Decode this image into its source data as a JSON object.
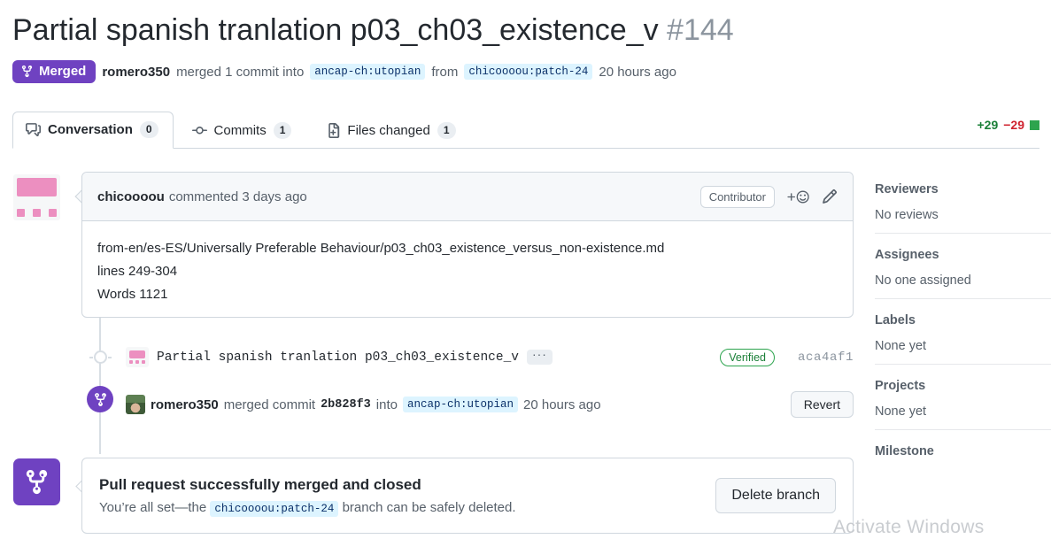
{
  "header": {
    "title": "Partial spanish tranlation p03_ch03_existence_v",
    "number": "#144",
    "state_badge": "Merged",
    "state_icon": "git-merge-icon",
    "merger": "romero350",
    "merge_text": "merged 1 commit into",
    "base_branch": "ancap-ch:utopian",
    "from_word": "from",
    "head_branch": "chicoooou:patch-24",
    "time": "20 hours ago",
    "state_color": "#6f42c1"
  },
  "tabs": [
    {
      "label": "Conversation",
      "count": "0",
      "icon": "comment-discussion-icon",
      "active": true
    },
    {
      "label": "Commits",
      "count": "1",
      "icon": "git-commit-icon",
      "active": false
    },
    {
      "label": "Files changed",
      "count": "1",
      "icon": "file-diff-icon",
      "active": false
    }
  ],
  "diffstat": {
    "additions": "+29",
    "deletions": "−29",
    "add_color": "#1a7f37",
    "del_color": "#cf222e",
    "block_color": "#2da44e"
  },
  "comment": {
    "author": "chicoooou",
    "action": "commented 3 days ago",
    "badge": "Contributor",
    "reaction_icon": "add-reaction-icon",
    "edit_icon": "pencil-icon",
    "body_lines": [
      "from-en/es-ES/Universally Preferable Behaviour/p03_ch03_existence_versus_non-existence.md",
      "lines 249-304",
      "Words 1121"
    ]
  },
  "commit_row": {
    "message": "Partial spanish tranlation p03_ch03_existence_v",
    "ellipsis": "···",
    "verified": "Verified",
    "sha": "aca4af1"
  },
  "merged_row": {
    "user": "romero350",
    "text_before": "merged commit",
    "commit_sha": "2b828f3",
    "text_into": "into",
    "branch": "ancap-ch:utopian",
    "time": "20 hours ago",
    "revert_label": "Revert"
  },
  "merge_box": {
    "icon": "git-merge-icon",
    "title": "Pull request successfully merged and closed",
    "sub_before": "You’re all set—the",
    "branch": "chicoooou:patch-24",
    "sub_after": "branch can be safely deleted.",
    "delete_label": "Delete branch"
  },
  "sidebar": [
    {
      "title": "Reviewers",
      "value": "No reviews"
    },
    {
      "title": "Assignees",
      "value": "No one assigned"
    },
    {
      "title": "Labels",
      "value": "None yet"
    },
    {
      "title": "Projects",
      "value": "None yet"
    },
    {
      "title": "Milestone",
      "value": ""
    }
  ],
  "watermark": "Activate Windows"
}
